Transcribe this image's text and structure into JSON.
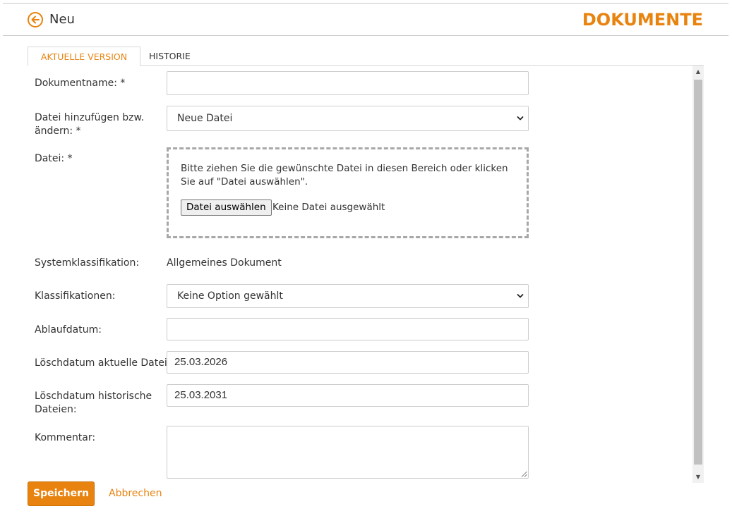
{
  "header": {
    "back_icon": "circle-arrow-left-icon",
    "title": "Neu",
    "module_title": "DOKUMENTE"
  },
  "tabs": [
    {
      "label": "AKTUELLE VERSION",
      "active": true
    },
    {
      "label": "HISTORIE",
      "active": false
    }
  ],
  "form": {
    "document_name": {
      "label": "Dokumentname: *",
      "value": ""
    },
    "file_action": {
      "label": "Datei hinzufügen bzw. ändern: *",
      "selected": "Neue Datei"
    },
    "file": {
      "label": "Datei: *",
      "instruction": "Bitte ziehen Sie die gewünschte Datei in diesen Bereich oder klicken Sie auf \"Datei auswählen\".",
      "button_label": "Datei auswählen",
      "status": "Keine Datei ausgewählt"
    },
    "system_classification": {
      "label": "Systemklassifikation:",
      "value": "Allgemeines Dokument"
    },
    "classifications": {
      "label": "Klassifikationen:",
      "selected": "Keine Option gewählt"
    },
    "expiry_date": {
      "label": "Ablaufdatum:",
      "value": ""
    },
    "delete_date_current": {
      "label": "Löschdatum aktuelle Datei:",
      "value": "25.03.2026"
    },
    "delete_date_history": {
      "label": "Löschdatum historische Dateien:",
      "value": "25.03.2031"
    },
    "comment": {
      "label": "Kommentar:",
      "value": ""
    }
  },
  "actions": {
    "save_label": "Speichern",
    "cancel_label": "Abbrechen"
  },
  "colors": {
    "accent": "#e8830f",
    "text": "#333333",
    "border": "#cccccc"
  }
}
